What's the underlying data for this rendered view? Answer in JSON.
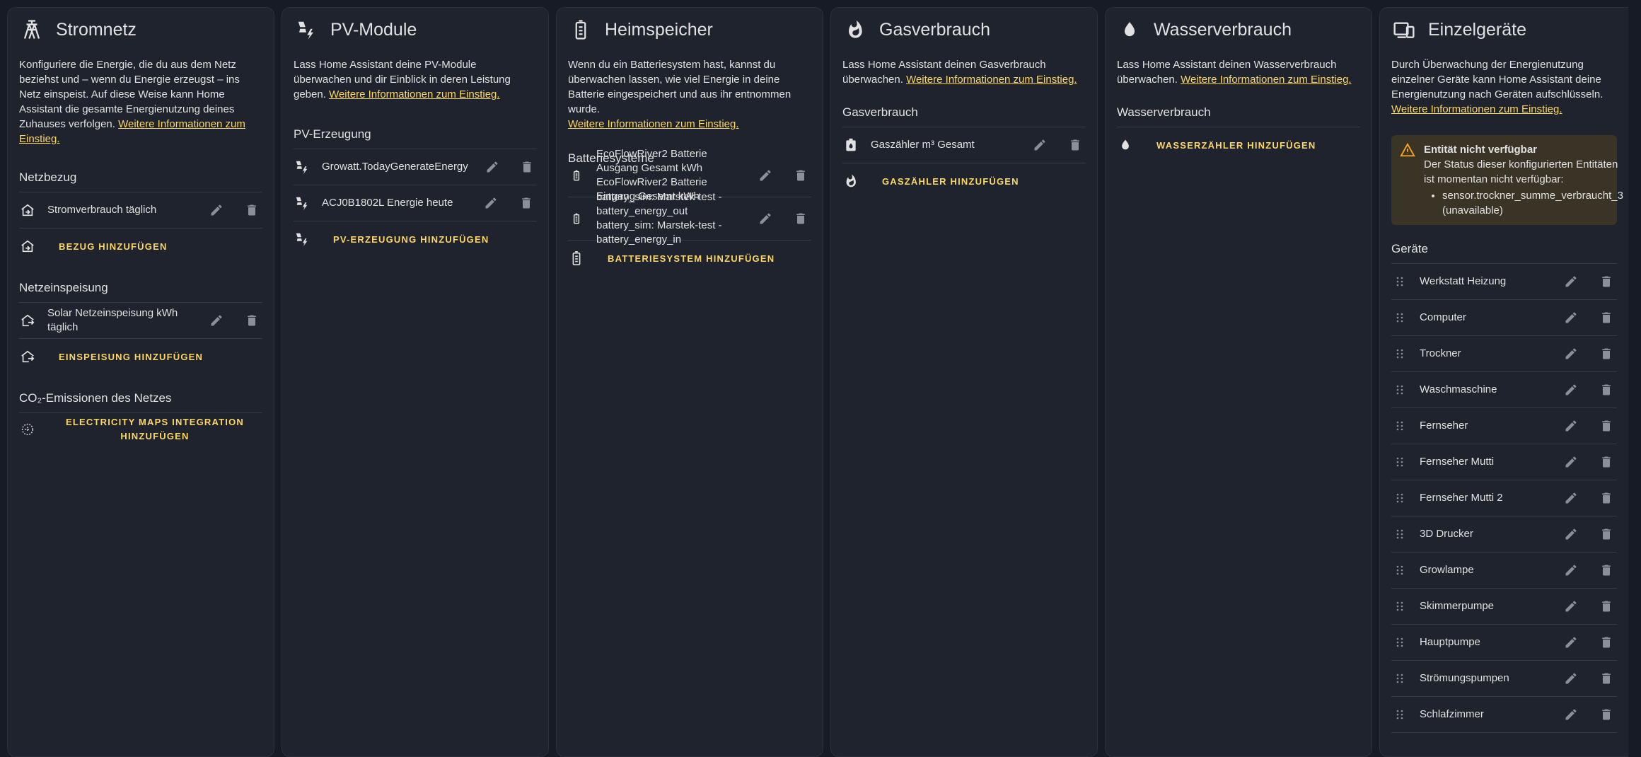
{
  "grid": {
    "title": "Stromnetz",
    "description": "Konfiguriere die Energie, die du aus dem Netz beziehst und – wenn du Energie erzeugst – ins Netz einspeist. Auf diese Weise kann Home Assistant die gesamte Energienutzung deines Zuhauses verfolgen.",
    "link": "Weitere Informationen zum Einstieg.",
    "consumption_title": "Netzbezug",
    "consumption_items": [
      {
        "label": "Stromverbrauch täglich"
      }
    ],
    "add_consumption": "Bezug hinzufügen",
    "return_title": "Netzeinspeisung",
    "return_items": [
      {
        "label": "Solar Netzeinspeisung kWh täglich"
      }
    ],
    "add_return": "Einspeisung hinzufügen",
    "co2_title": "CO₂-Emissionen des Netzes",
    "add_co2": "Electricity Maps Integration hinzufügen"
  },
  "solar": {
    "title": "PV-Module",
    "description": "Lass Home Assistant deine PV-Module überwachen und dir Einblick in deren Leistung geben.",
    "link": "Weitere Informationen zum Einstieg.",
    "section_title": "PV-Erzeugung",
    "items": [
      {
        "label": "Growatt.TodayGenerateEnergy"
      },
      {
        "label": "ACJ0B1802L Energie heute"
      }
    ],
    "add": "PV-Erzeugung hinzufügen"
  },
  "battery": {
    "title": "Heimspeicher",
    "description": "Wenn du ein Batteriesystem hast, kannst du überwachen lassen, wie viel Energie in deine Batterie eingespeichert und aus ihr entnommen wurde.",
    "link": "Weitere Informationen zum Einstieg.",
    "section_title": "Batteriesysteme",
    "items": [
      {
        "label": "EcoFlowRiver2 Batterie Ausgang Gesamt kWh EcoFlowRiver2 Batterie Eingang Gesamt kWh"
      },
      {
        "label": "battery_sim: Marstek-test - battery_energy_out battery_sim: Marstek-test - battery_energy_in"
      }
    ],
    "add": "Batteriesystem hinzufügen"
  },
  "gas": {
    "title": "Gasverbrauch",
    "description": "Lass Home Assistant deinen Gasverbrauch überwachen.",
    "link": "Weitere Informationen zum Einstieg.",
    "section_title": "Gasverbrauch",
    "items": [
      {
        "label": "Gaszähler m³ Gesamt"
      }
    ],
    "add": "Gaszähler hinzufügen"
  },
  "water": {
    "title": "Wasserverbrauch",
    "description": "Lass Home Assistant deinen Wasserverbrauch überwachen.",
    "link": "Weitere Informationen zum Einstieg.",
    "section_title": "Wasserverbrauch",
    "add": "Wasserzähler hinzufügen"
  },
  "devices": {
    "title": "Einzelgeräte",
    "description": "Durch Überwachung der Energienutzung einzelner Geräte kann Home Assistant deine Energienutzung nach Geräten aufschlüsseln.",
    "link": "Weitere Informationen zum Einstieg.",
    "warning_title": "Entität nicht verfügbar",
    "warning_text": "Der Status dieser konfigurierten Entitäten ist momentan nicht verfügbar:",
    "warning_entity": "sensor.trockner_summe_verbraucht_3 (unavailable)",
    "section_title": "Geräte",
    "items": [
      {
        "label": "Werkstatt Heizung"
      },
      {
        "label": "Computer"
      },
      {
        "label": "Trockner"
      },
      {
        "label": "Waschmaschine"
      },
      {
        "label": "Fernseher"
      },
      {
        "label": "Fernseher Mutti"
      },
      {
        "label": "Fernseher Mutti 2"
      },
      {
        "label": "3D Drucker"
      },
      {
        "label": "Growlampe"
      },
      {
        "label": "Skimmerpumpe"
      },
      {
        "label": "Hauptpumpe"
      },
      {
        "label": "Strömungspumpen"
      },
      {
        "label": "Schlafzimmer"
      }
    ]
  },
  "colors": {
    "accent": "#fdd663",
    "card": "#1e232e",
    "background": "#161b26",
    "warning": "#f5a623"
  },
  "icons": [
    "transmission-tower-icon",
    "solar-power-icon",
    "battery-icon",
    "fire-icon",
    "water-icon",
    "devices-icon",
    "pencil-icon",
    "trash-icon",
    "drag-handle-icon",
    "home-import-icon",
    "home-export-icon",
    "co2-icon",
    "alert-icon"
  ]
}
